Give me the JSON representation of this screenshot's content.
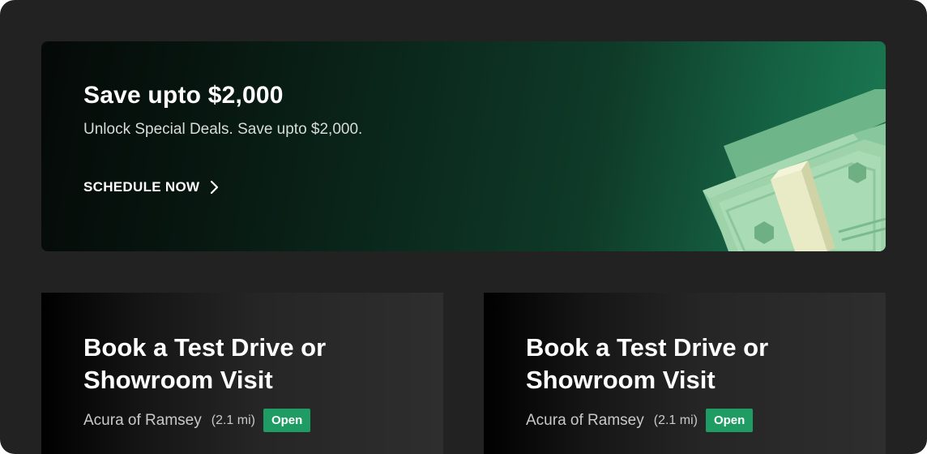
{
  "promo": {
    "title": "Save upto $2,000",
    "subtitle": "Unlock Special Deals. Save upto $2,000.",
    "cta_label": "SCHEDULE NOW",
    "cta_icon": "chevron-right-icon",
    "illustration": "money-stack-icon"
  },
  "cards": [
    {
      "title_line1": "Book a Test Drive or",
      "title_line2": "Showroom Visit",
      "dealer": "Acura of Ramsey",
      "distance": "(2.1 mi)",
      "status": "Open"
    },
    {
      "title_line1": "Book a Test Drive or",
      "title_line2": "Showroom Visit",
      "dealer": "Acura of Ramsey",
      "distance": "(2.1 mi)",
      "status": "Open"
    }
  ],
  "colors": {
    "background": "#222222",
    "promo_gradient_end": "#1b7a52",
    "status_open": "#1f9c64",
    "text_primary": "#ffffff"
  }
}
